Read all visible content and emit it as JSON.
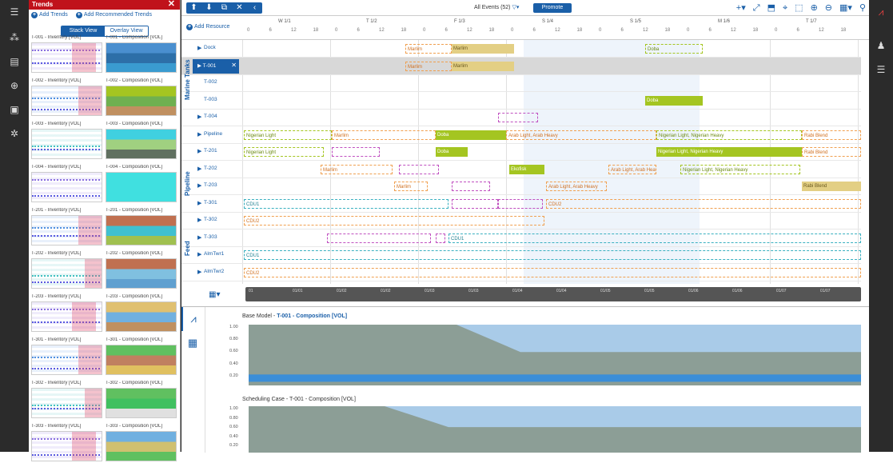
{
  "trends": {
    "title": "Trends",
    "add_trends": "Add Trends",
    "add_recommended": "Add Recommended Trends",
    "stack_view": "Stack View",
    "overlay_view": "Overlay View",
    "items": [
      {
        "inv": "T-001 - Inventory [VOL]",
        "comp": "T-001 - Composition [VOL]"
      },
      {
        "inv": "T-002 - Inventory [VOL]",
        "comp": "T-002 - Composition [VOL]"
      },
      {
        "inv": "T-003 - Inventory [VOL]",
        "comp": "T-003 - Composition [VOL]"
      },
      {
        "inv": "T-004 - Inventory [VOL]",
        "comp": "T-004 - Composition [VOL]"
      },
      {
        "inv": "T-201 - Inventory [VOL]",
        "comp": "T-201 - Composition [VOL]"
      },
      {
        "inv": "T-202 - Inventory [VOL]",
        "comp": "T-202 - Composition [VOL]"
      },
      {
        "inv": "T-203 - Inventory [VOL]",
        "comp": "T-203 - Composition [VOL]"
      },
      {
        "inv": "T-301 - Inventory [VOL]",
        "comp": "T-301 - Composition [VOL]"
      },
      {
        "inv": "T-302 - Inventory [VOL]",
        "comp": "T-302 - Composition [VOL]"
      },
      {
        "inv": "T-303 - Inventory [VOL]",
        "comp": "T-303 - Composition [VOL]"
      }
    ]
  },
  "toolbar": {
    "events": "All Events (52)",
    "promote": "Promote"
  },
  "gantt": {
    "add_resource": "Add Resource",
    "days": [
      "W 1/1",
      "T 1/2",
      "F 1/3",
      "S 1/4",
      "S 1/5",
      "M 1/6",
      "T 1/7"
    ],
    "hours": [
      "0",
      "6",
      "12",
      "18"
    ],
    "groups": {
      "marine": "Marine Tanks",
      "pipeline": "Pipeline",
      "feed": "Feed"
    },
    "rows": [
      {
        "label": "Dock",
        "arrow": true
      },
      {
        "label": "T-001",
        "arrow": true,
        "selected": true
      },
      {
        "label": "T-002",
        "arrow": false
      },
      {
        "label": "T-003",
        "arrow": false
      },
      {
        "label": "T-004",
        "arrow": true
      },
      {
        "label": "Pipeline",
        "arrow": true
      },
      {
        "label": "T-201",
        "arrow": true
      },
      {
        "label": "T-202",
        "arrow": true
      },
      {
        "label": "T-203",
        "arrow": true
      },
      {
        "label": "T-301",
        "arrow": true
      },
      {
        "label": "T-302",
        "arrow": true
      },
      {
        "label": "T-303",
        "arrow": true
      },
      {
        "label": "AlmTwr1",
        "arrow": true
      },
      {
        "label": "AlmTwr2",
        "arrow": true
      }
    ],
    "bars": {
      "marlim": "Marlim",
      "ekofisk": "Ekofisk",
      "doba": "Doba",
      "nigerian_light": "Nigerian Light",
      "nigerian_light_heavy": "Nigerian Light, Nigerian Heavy",
      "arab_light_heavy": "Arab Light, Arab Heavy",
      "rabi_blend": "Rabi Blend",
      "cdu1": "CDU1",
      "cdu2": "CDU2"
    },
    "scroll_ticks": [
      "01",
      "01/01",
      "01/02",
      "01/02",
      "01/03",
      "01/03",
      "01/04",
      "01/04",
      "01/05",
      "01/05",
      "01/06",
      "01/06",
      "01/07",
      "01/07"
    ]
  },
  "bottom": {
    "chart1_prefix": "Base Model - ",
    "chart1_title": "T-001 - Composition [VOL]",
    "chart2_title": "Scheduling Case - T-001 - Composition [VOL]",
    "yticks": [
      "1.00",
      "0.80",
      "0.60",
      "0.40",
      "0.20"
    ]
  },
  "colors": {
    "accent": "#1a5fa8",
    "brand": "#c0121b",
    "green": "#a4c521",
    "tan": "#e3cf84"
  }
}
